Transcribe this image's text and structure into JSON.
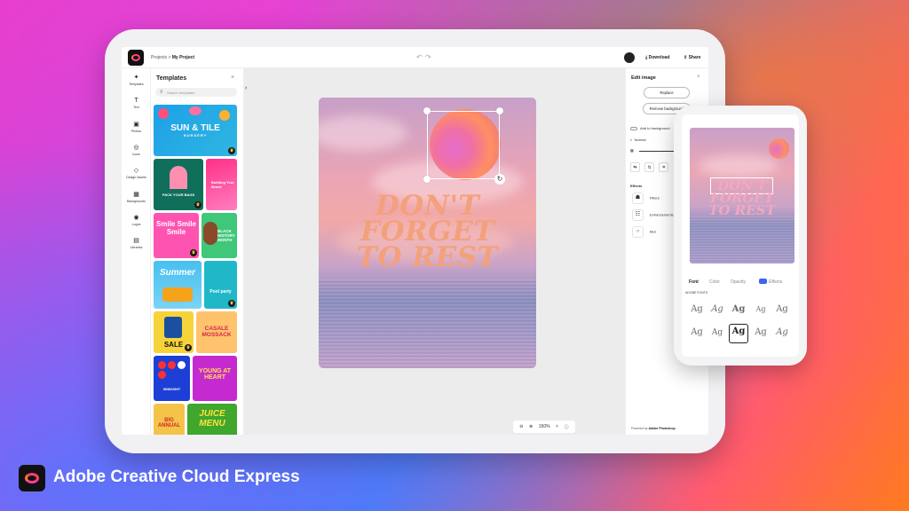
{
  "topbar": {
    "breadcrumb_root": "Projects",
    "breadcrumb_sep": ">",
    "breadcrumb_current": "My Project",
    "download_label": "Download",
    "share_label": "Share"
  },
  "rail": [
    {
      "label": "Templates",
      "icon": "templates-icon"
    },
    {
      "label": "Text",
      "icon": "text-icon"
    },
    {
      "label": "Photos",
      "icon": "photos-icon"
    },
    {
      "label": "Icons",
      "icon": "icons-icon"
    },
    {
      "label": "Design Assets",
      "icon": "design-assets-icon"
    },
    {
      "label": "Backgrounds",
      "icon": "backgrounds-icon"
    },
    {
      "label": "Logos",
      "icon": "logos-icon"
    },
    {
      "label": "Libraries",
      "icon": "libraries-icon"
    }
  ],
  "templates": {
    "title": "Templates",
    "search_placeholder": "Search templates",
    "tiles": [
      {
        "text": "SUN & TILE",
        "sub": "NURSERY"
      },
      {
        "text": "PACK YOUR BAGS"
      },
      {
        "text": "Building Your Brand"
      },
      {
        "text": "Smile Smile Smile"
      },
      {
        "text": "BLACK HISTORY MONTH"
      },
      {
        "text": "Summer"
      },
      {
        "text": "Pool party"
      },
      {
        "text": "SALE"
      },
      {
        "text": "CASALE MOSSACK"
      },
      {
        "text": "HINDSIGHT"
      },
      {
        "text": "YOUNG AT HEART"
      },
      {
        "text": "BIG ANNUAL"
      },
      {
        "text": "JUICE MENU"
      }
    ]
  },
  "canvas": {
    "headline_lines": [
      "DON'T",
      "FORGET",
      "TO REST"
    ],
    "zoom_label": "150%"
  },
  "edit_panel": {
    "title": "Edit image",
    "replace_label": "Replace",
    "remove_bg_label": "Remove background",
    "add_bg_label": "Add to background",
    "blend_label": "Normal",
    "effects_label": "Effects",
    "effects": [
      "Filters",
      "Enhancements",
      "Blur"
    ],
    "powered_prefix": "Powered by",
    "powered_brand": "Adobe Photoshop"
  },
  "phone": {
    "headline_lines": [
      "DON'T",
      "FORGET",
      "TO REST"
    ],
    "tabs": [
      "Font",
      "Color",
      "Opacity",
      "Effects"
    ],
    "fonts_label": "ADOBE FONTS",
    "font_samples": [
      "Ag",
      "Ag",
      "Ag",
      "Ag",
      "Ag",
      "Ag",
      "Ag",
      "Ag",
      "Ag",
      "Ag"
    ]
  },
  "brand": {
    "name": "Adobe Creative Cloud Express"
  },
  "colors": {
    "headline": "#f3a17c",
    "accent_blue": "#3a66f0"
  }
}
